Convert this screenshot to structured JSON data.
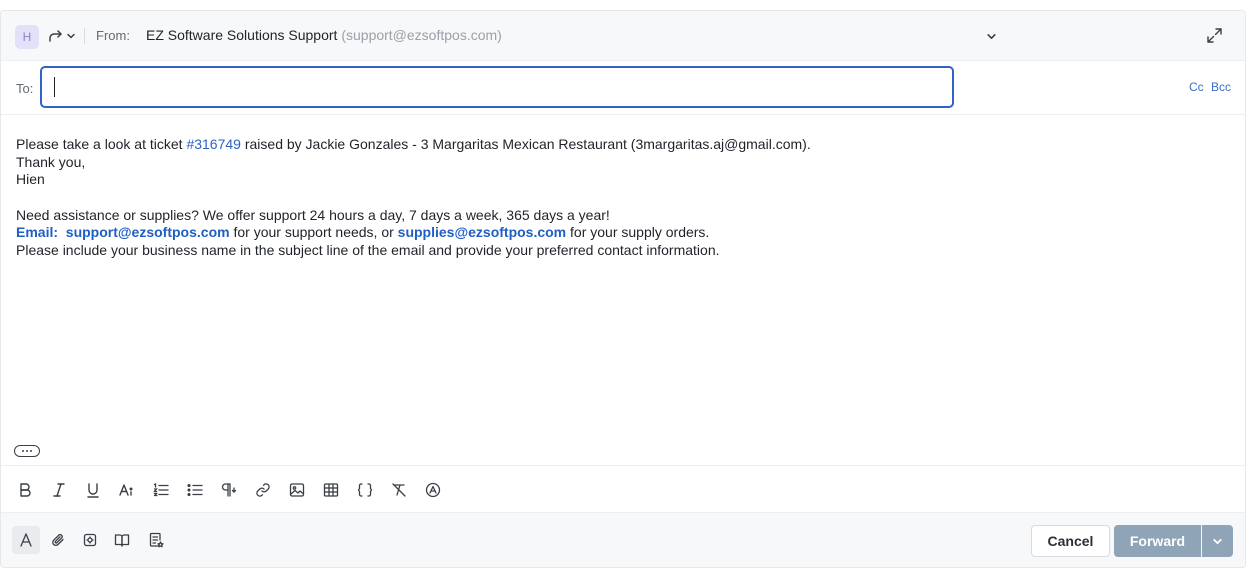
{
  "header": {
    "avatar_initial": "H",
    "from_label": "From:",
    "from_name": "EZ Software Solutions Support",
    "from_email": "(support@ezsoftpos.com)"
  },
  "to": {
    "label": "To:",
    "value": "",
    "cc_label": "Cc",
    "bcc_label": "Bcc"
  },
  "message": {
    "line1_pre": "Please take a look at ticket ",
    "ticket_link": "#316749",
    "line1_post": " raised by Jackie Gonzales - 3 Margaritas Mexican Restaurant (3margaritas.aj@gmail.com).",
    "line2": "Thank you,",
    "line3": "Hien",
    "signature_intro": "Need assistance or supplies? We offer support 24 hours a day, 7 days a week, 365 days a year!",
    "email_label": "Email:",
    "support_email": "support@ezsoftpos.com",
    "support_mid": " for your support needs, or ",
    "supplies_email": "supplies@ezsoftpos.com",
    "supplies_post": " for your supply orders.",
    "signature_note": "Please include your business name in the subject line of the email and provide your preferred contact information."
  },
  "toolbar": {
    "icons": [
      "bold-icon",
      "italic-icon",
      "underline-icon",
      "font-size-icon",
      "numbered-list-icon",
      "bullet-list-icon",
      "paragraph-icon",
      "link-icon",
      "image-icon",
      "table-icon",
      "code-icon",
      "clear-format-icon",
      "mention-icon"
    ]
  },
  "footer": {
    "icons": [
      "text-format-icon",
      "attachment-icon",
      "canned-response-icon",
      "knowledge-base-icon",
      "template-icon"
    ],
    "cancel_label": "Cancel",
    "forward_label": "Forward"
  },
  "colors": {
    "accent": "#2f63c4",
    "forward_button": "#8fa5b7",
    "header_bg": "#f7f8fa"
  }
}
